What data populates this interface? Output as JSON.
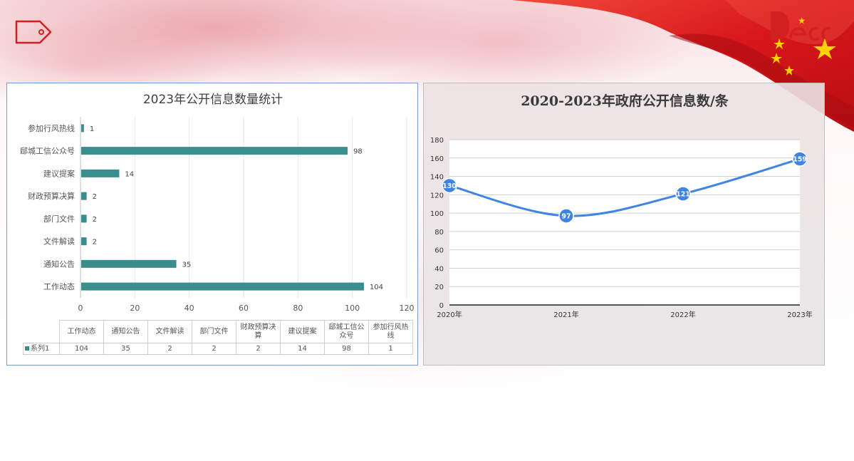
{
  "left_chart": {
    "title": "2023年公开信息数量统计"
  },
  "right_chart": {
    "title": "2020-2023年政府公开信息数/条"
  },
  "data_table": {
    "series_label": "系列1"
  },
  "colors": {
    "bar": "#3a8e8e",
    "line": "#3f84e4",
    "accent_red": "#d21f1f"
  },
  "icons": {
    "tag": "tag-icon",
    "logo": "logo-mark",
    "flag": "flag-decoration"
  },
  "chart_data": [
    {
      "type": "bar",
      "orientation": "horizontal",
      "title": "2023年公开信息数量统计",
      "categories": [
        "工作动态",
        "通知公告",
        "文件解读",
        "部门文件",
        "财政预算决算",
        "建议提案",
        "郈城工信公众号",
        "参加行风热线"
      ],
      "series": [
        {
          "name": "系列1",
          "values": [
            104,
            35,
            2,
            2,
            2,
            14,
            98,
            1
          ]
        }
      ],
      "xlim": [
        0,
        120
      ],
      "xticks": [
        "0",
        "20",
        "40",
        "60",
        "80",
        "100",
        "120"
      ],
      "grid": true,
      "data_table": true
    },
    {
      "type": "line",
      "smooth": true,
      "title": "2020-2023年政府公开信息数/条",
      "categories": [
        "2020年",
        "2021年",
        "2022年",
        "2023年"
      ],
      "series": [
        {
          "values": [
            130,
            97,
            121,
            159
          ]
        }
      ],
      "ylim": [
        0,
        180
      ],
      "yticks": [
        "0",
        "20",
        "40",
        "60",
        "80",
        "100",
        "120",
        "140",
        "160",
        "180"
      ],
      "grid": true
    }
  ]
}
